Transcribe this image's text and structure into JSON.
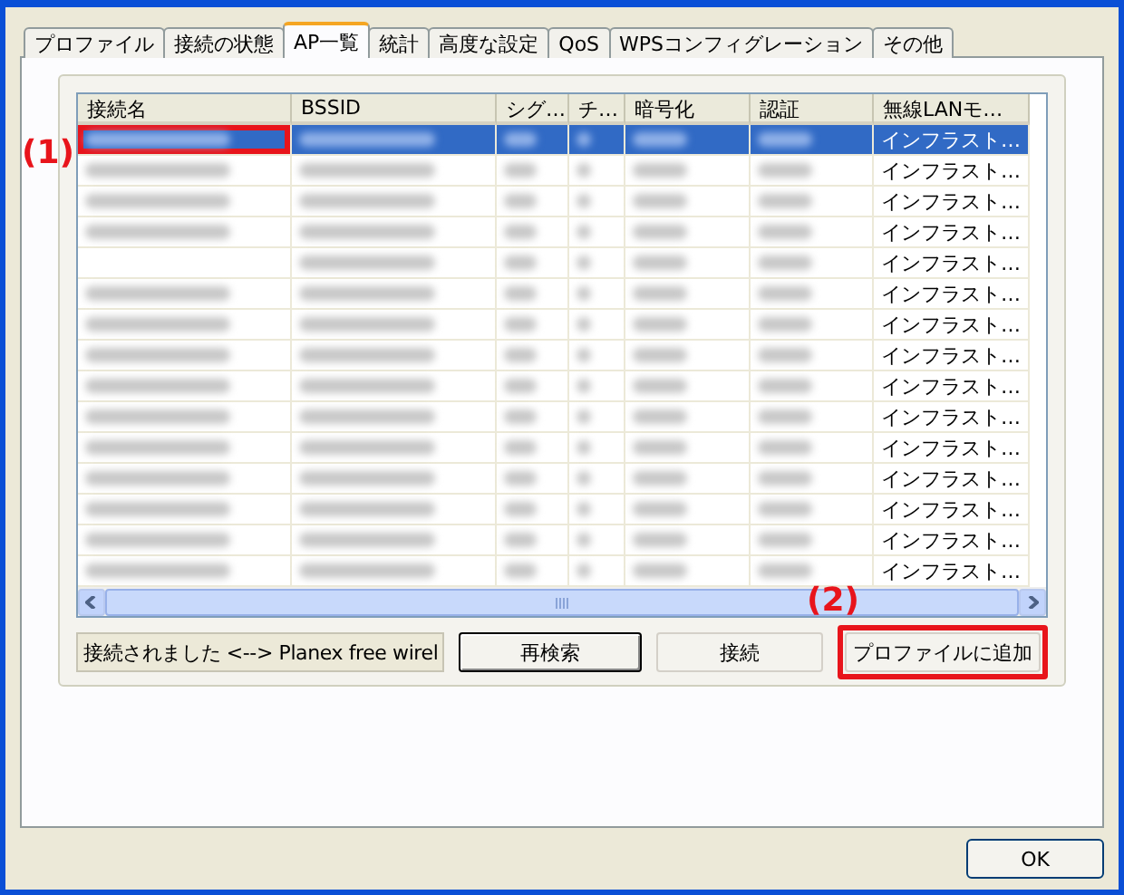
{
  "tabs": [
    {
      "label": "プロファイル",
      "selected": false
    },
    {
      "label": "接続の状態",
      "selected": false
    },
    {
      "label": "AP一覧",
      "selected": true
    },
    {
      "label": "統計",
      "selected": false
    },
    {
      "label": "高度な設定",
      "selected": false
    },
    {
      "label": "QoS",
      "selected": false
    },
    {
      "label": "WPSコンフィグレーション",
      "selected": false
    },
    {
      "label": "その他",
      "selected": false
    }
  ],
  "table": {
    "columns": [
      "接続名",
      "BSSID",
      "シグ…",
      "チ…",
      "暗号化",
      "認証",
      "無線LANモ…"
    ],
    "rows": [
      {
        "selected": true,
        "blurred": [
          true,
          true,
          true,
          true,
          true,
          true
        ],
        "mode": "インフラスト…"
      },
      {
        "selected": false,
        "blurred": [
          true,
          true,
          true,
          true,
          true,
          true
        ],
        "mode": "インフラスト…"
      },
      {
        "selected": false,
        "blurred": [
          true,
          true,
          true,
          true,
          true,
          true
        ],
        "mode": "インフラスト…"
      },
      {
        "selected": false,
        "blurred": [
          true,
          true,
          true,
          true,
          true,
          true
        ],
        "mode": "インフラスト…"
      },
      {
        "selected": false,
        "blurred": [
          false,
          true,
          true,
          true,
          true,
          true
        ],
        "mode": "インフラスト…"
      },
      {
        "selected": false,
        "blurred": [
          true,
          true,
          true,
          true,
          true,
          true
        ],
        "mode": "インフラスト…"
      },
      {
        "selected": false,
        "blurred": [
          true,
          true,
          true,
          true,
          true,
          true
        ],
        "mode": "インフラスト…"
      },
      {
        "selected": false,
        "blurred": [
          true,
          true,
          true,
          true,
          true,
          true
        ],
        "mode": "インフラスト…"
      },
      {
        "selected": false,
        "blurred": [
          true,
          true,
          true,
          true,
          true,
          true
        ],
        "mode": "インフラスト…"
      },
      {
        "selected": false,
        "blurred": [
          true,
          true,
          true,
          true,
          true,
          true
        ],
        "mode": "インフラスト…"
      },
      {
        "selected": false,
        "blurred": [
          true,
          true,
          true,
          true,
          true,
          true
        ],
        "mode": "インフラスト…"
      },
      {
        "selected": false,
        "blurred": [
          true,
          true,
          true,
          true,
          true,
          true
        ],
        "mode": "インフラスト…"
      },
      {
        "selected": false,
        "blurred": [
          true,
          true,
          true,
          true,
          true,
          true
        ],
        "mode": "インフラスト…"
      },
      {
        "selected": false,
        "blurred": [
          true,
          true,
          true,
          true,
          true,
          true
        ],
        "mode": "インフラスト…"
      },
      {
        "selected": false,
        "blurred": [
          true,
          true,
          true,
          true,
          true,
          true
        ],
        "mode": "インフラスト…"
      }
    ]
  },
  "status": "接続されました <--> Planex free wirel",
  "buttons": [
    {
      "label": "再検索",
      "default": true
    },
    {
      "label": "接続",
      "default": false
    },
    {
      "label": "プロファイルに追加",
      "default": false
    }
  ],
  "annotations": [
    "(1)",
    "(2)"
  ],
  "ok_button": "OK"
}
